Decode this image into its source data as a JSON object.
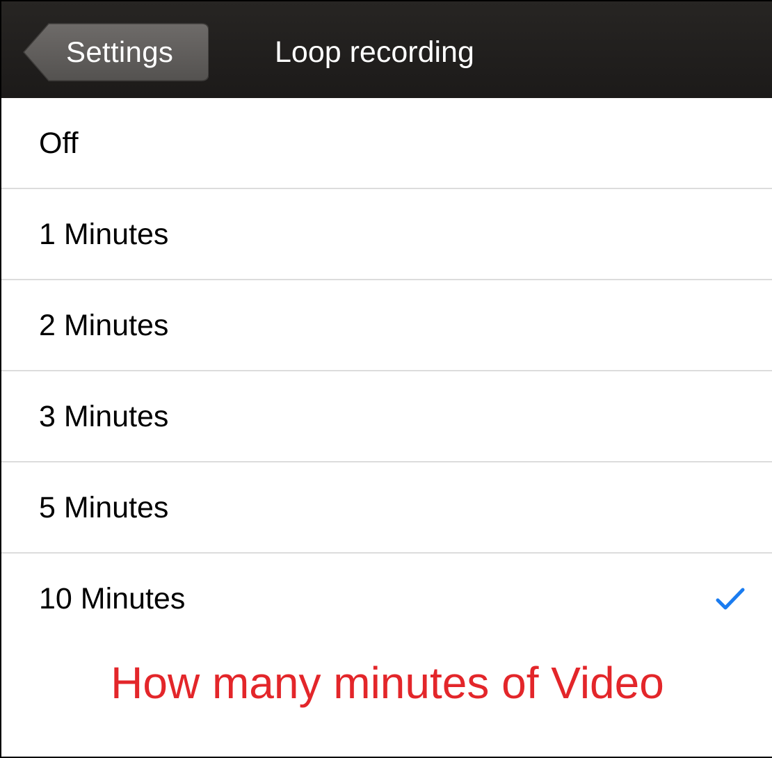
{
  "navbar": {
    "back_label": "Settings",
    "title": "Loop recording"
  },
  "options": [
    {
      "label": "Off",
      "selected": false
    },
    {
      "label": "1 Minutes",
      "selected": false
    },
    {
      "label": "2 Minutes",
      "selected": false
    },
    {
      "label": "3 Minutes",
      "selected": false
    },
    {
      "label": "5 Minutes",
      "selected": false
    },
    {
      "label": "10 Minutes",
      "selected": true
    }
  ],
  "annotation": "How many minutes of Video",
  "colors": {
    "navbar_bg": "#1c1a19",
    "check": "#1a7cf0",
    "annotation": "#e3262a",
    "separator": "#dcdcdc"
  },
  "icons": {
    "back": "back-arrow-button",
    "selected": "checkmark-icon"
  }
}
